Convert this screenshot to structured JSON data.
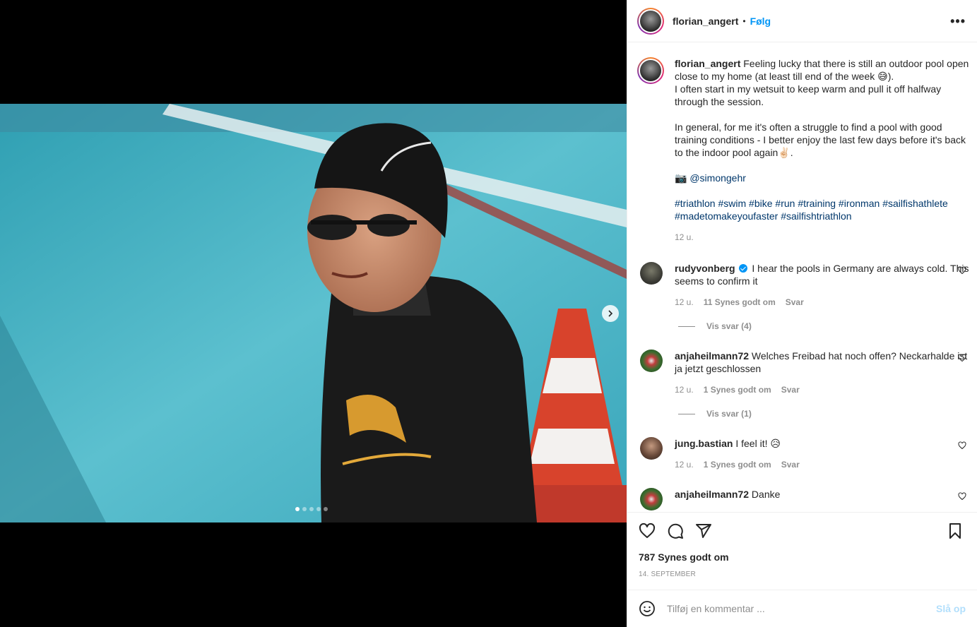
{
  "post": {
    "author": "florian_angert",
    "follow_label": "Følg",
    "separator": "•",
    "more_icon": "more-horizontal-icon"
  },
  "caption": {
    "username": "florian_angert",
    "text_1": " Feeling lucky that there is still an outdoor pool open close to my home (at least till end of the week 😅).\nI often start in my wetsuit to keep warm and pull it off halfway through the session.\n\nIn general, for me it's often a struggle to find a pool with good training conditions - I better enjoy the last few days before it's back to the indoor pool again✌🏻.\n\n📷 ",
    "mention": "@simongehr",
    "hashtags_line_1": [
      "#triathlon",
      "#swim",
      "#bike",
      "#run",
      "#training",
      "#ironman",
      "#sailfishathlete"
    ],
    "hashtags_line_2": [
      "#madetomakeyoufaster",
      "#sailfishtriathlon"
    ],
    "time": "12 u."
  },
  "comments": [
    {
      "username": "rudyvonberg",
      "verified": true,
      "text": " I hear the pools in Germany are always cold. This seems to confirm it",
      "time": "12 u.",
      "likes": "11 Synes godt om",
      "reply": "Svar",
      "view_replies": "Vis svar (4)"
    },
    {
      "username": "anjaheilmann72",
      "text": " Welches Freibad hat noch offen? Neckarhalde ist ja jetzt geschlossen",
      "time": "12 u.",
      "likes": "1 Synes godt om",
      "reply": "Svar",
      "view_replies": "Vis svar (1)"
    },
    {
      "username": "jung.bastian",
      "text": " I feel it! 😥",
      "time": "12 u.",
      "likes": "1 Synes godt om",
      "reply": "Svar"
    },
    {
      "username": "anjaheilmann72",
      "text": " Danke"
    }
  ],
  "actions": {
    "likes": "787 Synes godt om",
    "date": "14. SEPTEMBER"
  },
  "add_comment": {
    "placeholder": "Tilføj en kommentar ...",
    "post_label": "Slå op"
  },
  "carousel": {
    "total": 5,
    "active": 1
  },
  "colors": {
    "link": "#00376b",
    "follow": "#0095f6",
    "muted": "#8e8e8e",
    "post_disabled": "#b2dffc"
  }
}
